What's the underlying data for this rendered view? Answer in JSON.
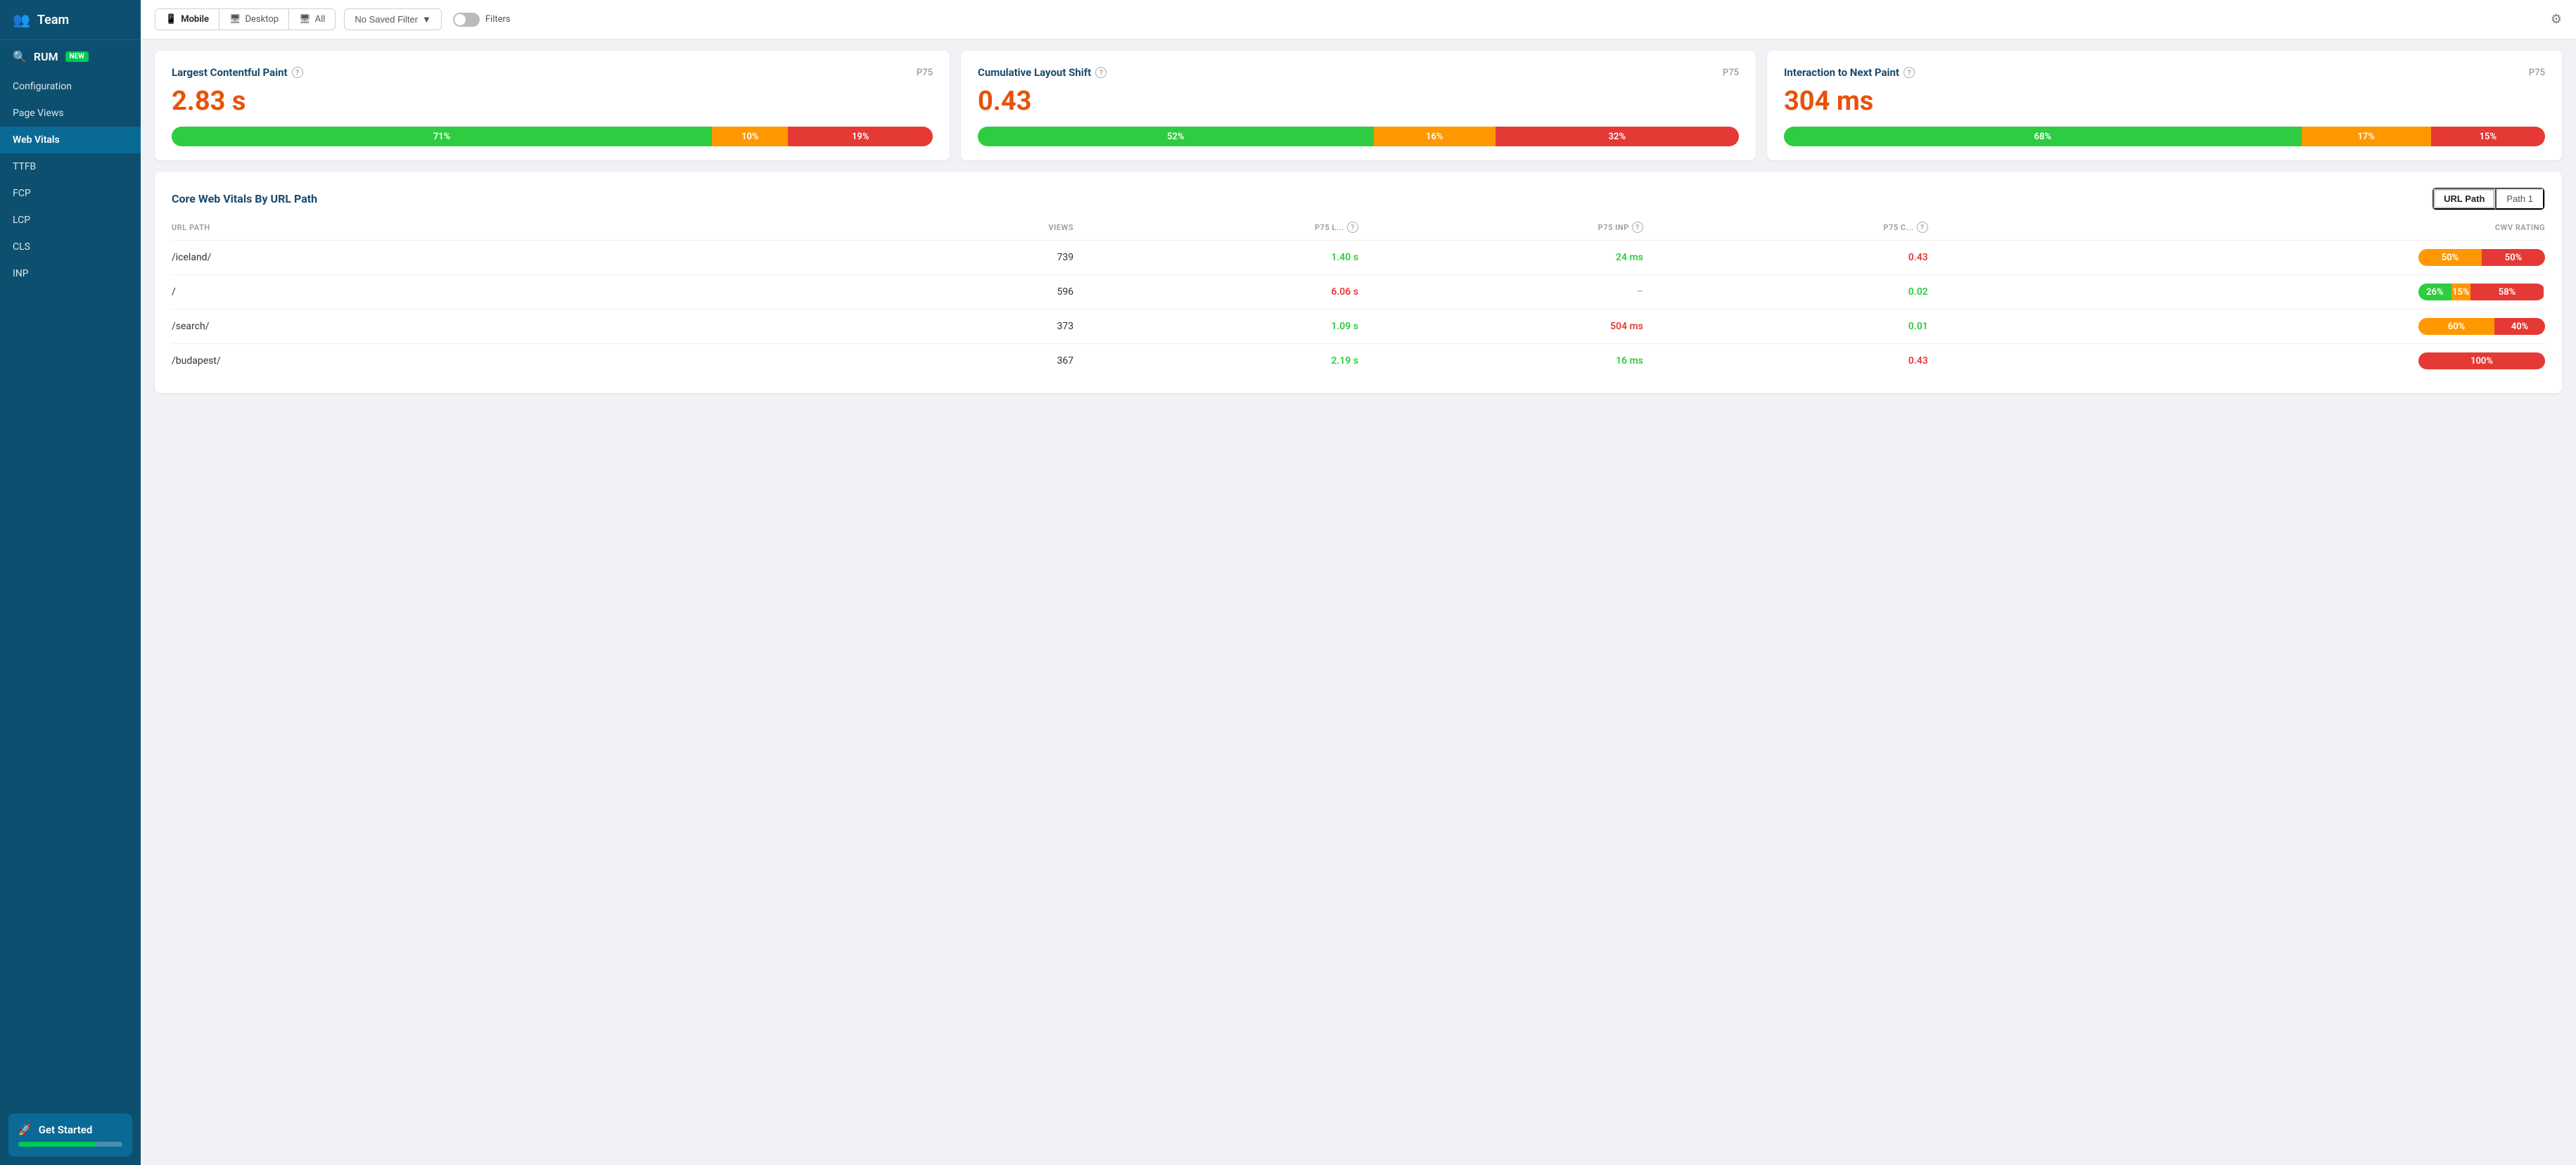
{
  "sidebar": {
    "team_label": "Team",
    "rum_label": "RUM",
    "new_badge": "NEW",
    "nav_items": [
      {
        "label": "Configuration",
        "active": false
      },
      {
        "label": "Page Views",
        "active": false
      },
      {
        "label": "Web Vitals",
        "active": true
      },
      {
        "label": "TTFB",
        "active": false
      },
      {
        "label": "FCP",
        "active": false
      },
      {
        "label": "LCP",
        "active": false
      },
      {
        "label": "CLS",
        "active": false
      },
      {
        "label": "INP",
        "active": false
      }
    ],
    "get_started_label": "Get Started",
    "progress_pct": 75
  },
  "topbar": {
    "mobile_label": "Mobile",
    "desktop_label": "Desktop",
    "all_label": "All",
    "filter_label": "No Saved Filter",
    "filters_label": "Filters"
  },
  "vitals": [
    {
      "title": "Largest Contentful Paint",
      "percentile": "P75",
      "value": "2.83 s",
      "bar": [
        {
          "pct": 71,
          "label": "71%",
          "color": "green"
        },
        {
          "pct": 10,
          "label": "10%",
          "color": "orange"
        },
        {
          "pct": 19,
          "label": "19%",
          "color": "red"
        }
      ]
    },
    {
      "title": "Cumulative Layout Shift",
      "percentile": "P75",
      "value": "0.43",
      "bar": [
        {
          "pct": 52,
          "label": "52%",
          "color": "green"
        },
        {
          "pct": 16,
          "label": "16%",
          "color": "orange"
        },
        {
          "pct": 32,
          "label": "32%",
          "color": "red"
        }
      ]
    },
    {
      "title": "Interaction to Next Paint",
      "percentile": "P75",
      "value": "304 ms",
      "bar": [
        {
          "pct": 68,
          "label": "68%",
          "color": "green"
        },
        {
          "pct": 17,
          "label": "17%",
          "color": "orange"
        },
        {
          "pct": 15,
          "label": "15%",
          "color": "red"
        }
      ]
    }
  ],
  "table": {
    "title": "Core Web Vitals By URL Path",
    "path_btn_1": "URL Path",
    "path_btn_2": "Path 1",
    "col_url": "URL PATH",
    "col_views": "VIEWS",
    "col_lcp": "P75 L...",
    "col_inp": "P75 INP",
    "col_cls": "P75 C...",
    "col_cwv": "CWV RATING",
    "rows": [
      {
        "path": "/iceland/",
        "views": "739",
        "lcp": "1.40 s",
        "lcp_color": "green",
        "inp": "24 ms",
        "inp_color": "green",
        "cls": "0.43",
        "cls_color": "red",
        "cwv": [
          {
            "pct": 50,
            "label": "50%",
            "color": "orange"
          },
          {
            "pct": 50,
            "label": "50%",
            "color": "red"
          }
        ]
      },
      {
        "path": "/",
        "views": "596",
        "lcp": "6.06 s",
        "lcp_color": "red",
        "inp": "–",
        "inp_color": "dash",
        "cls": "0.02",
        "cls_color": "green",
        "cwv": [
          {
            "pct": 26,
            "label": "26%",
            "color": "green"
          },
          {
            "pct": 15,
            "label": "15%",
            "color": "orange"
          },
          {
            "pct": 58,
            "label": "58%",
            "color": "red"
          }
        ]
      },
      {
        "path": "/search/",
        "views": "373",
        "lcp": "1.09 s",
        "lcp_color": "green",
        "inp": "504 ms",
        "inp_color": "red",
        "cls": "0.01",
        "cls_color": "green",
        "cwv": [
          {
            "pct": 60,
            "label": "60%",
            "color": "orange"
          },
          {
            "pct": 40,
            "label": "40%",
            "color": "red"
          }
        ]
      },
      {
        "path": "/budapest/",
        "views": "367",
        "lcp": "2.19 s",
        "lcp_color": "green",
        "inp": "16 ms",
        "inp_color": "green",
        "cls": "0.43",
        "cls_color": "red",
        "cwv": [
          {
            "pct": 100,
            "label": "100%",
            "color": "red"
          }
        ]
      }
    ]
  }
}
